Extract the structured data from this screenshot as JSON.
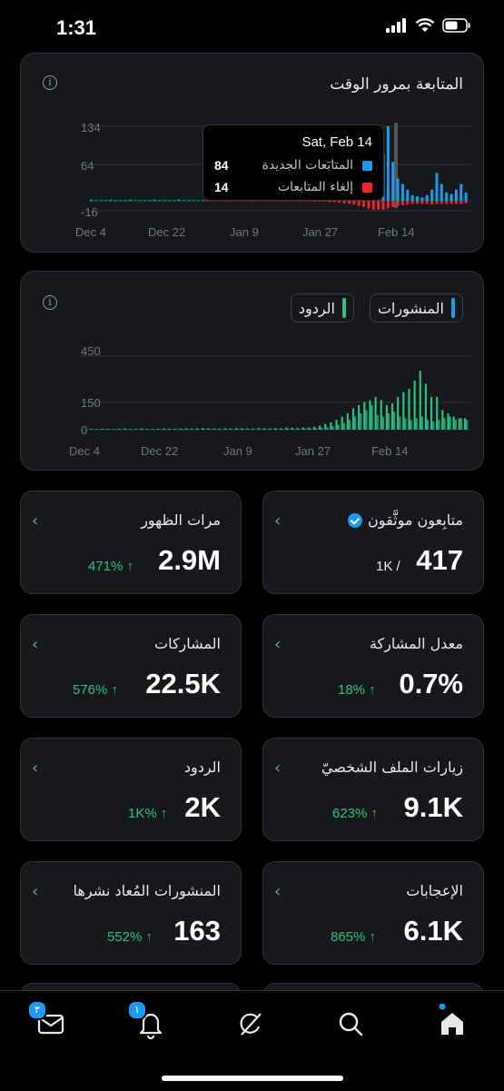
{
  "status": {
    "time": "1:31"
  },
  "followers_card": {
    "title": "المتابعة بمرور الوقت",
    "y_ticks": [
      "134",
      "64",
      "-16"
    ],
    "x_ticks": [
      "Dec 4",
      "Dec 22",
      "Jan 9",
      "Jan 27",
      "Feb 14"
    ],
    "tooltip": {
      "date": "Sat, Feb 14",
      "new_label": "المتابَعات الجديدة",
      "new_value": "84",
      "lost_label": "إلغاء المتابعات",
      "lost_value": "14"
    }
  },
  "posts_card": {
    "chip_posts": "المنشورات",
    "chip_replies": "الردود",
    "y_ticks": [
      "450",
      "150",
      "0"
    ],
    "x_ticks": [
      "Dec 4",
      "Dec 22",
      "Jan 9",
      "Jan 27",
      "Feb 14"
    ]
  },
  "stats": {
    "verified_followers": {
      "title": "متابِعون موثَّقون",
      "value": "417",
      "sub": "1K /"
    },
    "impressions": {
      "title": "مرات الظهور",
      "value": "2.9M",
      "change": "471% ↑"
    },
    "engagement_rate": {
      "title": "معدل المشاركة",
      "value": "0.7%",
      "change": "18% ↑"
    },
    "engagements": {
      "title": "المشاركات",
      "value": "22.5K",
      "change": "576% ↑"
    },
    "profile_visits": {
      "title": "زيارات الملف الشخصيّ",
      "value": "9.1K",
      "change": "623% ↑"
    },
    "replies": {
      "title": "الردود",
      "value": "2K",
      "change": "1K% ↑"
    },
    "likes": {
      "title": "الإعجابات",
      "value": "6.1K",
      "change": "865% ↑"
    },
    "reposts": {
      "title": "المنشورات المُعاد نشرها",
      "value": "163",
      "change": "552% ↑"
    }
  },
  "nav": {
    "messages_badge": "٣",
    "notifications_badge": "١"
  },
  "colors": {
    "accent": "#1d9bf0",
    "loss": "#f4212e",
    "positive": "#2ec27e",
    "posts_bar": "#1fa17a",
    "replies_bar": "#2ec27e"
  },
  "chart_data": [
    {
      "type": "bar",
      "title": "المتابعة بمرور الوقت",
      "x_range": [
        "Dec 4",
        "Feb 20"
      ],
      "ylim": [
        -16,
        134
      ],
      "series": [
        {
          "name": "المتابَعات الجديدة",
          "values": [
            2,
            1,
            1,
            1,
            2,
            1,
            1,
            1,
            2,
            1,
            1,
            1,
            1,
            2,
            1,
            1,
            1,
            1,
            2,
            1,
            1,
            1,
            1,
            1,
            2,
            1,
            1,
            1,
            1,
            2,
            1,
            1,
            1,
            1,
            1,
            2,
            1,
            1,
            1,
            2,
            1,
            1,
            1,
            2,
            1,
            2,
            2,
            1,
            2,
            3,
            2,
            3,
            4,
            5,
            8,
            12,
            15,
            20,
            40,
            60,
            84,
            140,
            70,
            40,
            30,
            20,
            10,
            8,
            6,
            10,
            20,
            50,
            30,
            15,
            12,
            20,
            30,
            15
          ]
        },
        {
          "name": "إلغاء المتابعات",
          "values": [
            0,
            0,
            0,
            0,
            0,
            1,
            0,
            0,
            0,
            0,
            0,
            1,
            0,
            0,
            0,
            0,
            0,
            1,
            0,
            0,
            0,
            0,
            0,
            1,
            0,
            0,
            0,
            0,
            1,
            0,
            0,
            0,
            0,
            1,
            0,
            0,
            0,
            1,
            0,
            0,
            1,
            0,
            0,
            1,
            0,
            1,
            1,
            1,
            1,
            2,
            2,
            3,
            4,
            5,
            6,
            8,
            10,
            12,
            14,
            14,
            14,
            12,
            10,
            8,
            7,
            6,
            5,
            5,
            5,
            5,
            6,
            5,
            5,
            5,
            5,
            5,
            5,
            4
          ]
        }
      ]
    },
    {
      "type": "bar",
      "x_range": [
        "Dec 4",
        "Feb 20"
      ],
      "ylim": [
        0,
        450
      ],
      "series": [
        {
          "name": "المنشورات",
          "values": [
            3,
            2,
            4,
            3,
            2,
            3,
            4,
            2,
            3,
            4,
            3,
            2,
            3,
            5,
            4,
            3,
            4,
            5,
            3,
            4,
            6,
            5,
            4,
            3,
            5,
            4,
            6,
            5,
            4,
            3,
            6,
            5,
            4,
            6,
            5,
            7,
            6,
            5,
            8,
            7,
            9,
            12,
            15,
            20,
            30,
            40,
            60,
            80,
            100,
            120,
            150,
            90,
            80,
            100,
            110,
            80,
            70,
            60,
            70,
            80,
            60,
            50,
            60,
            70,
            80,
            60,
            70,
            60
          ]
        },
        {
          "name": "الردود",
          "values": [
            5,
            4,
            6,
            5,
            4,
            6,
            7,
            5,
            6,
            8,
            6,
            5,
            6,
            8,
            7,
            6,
            7,
            9,
            7,
            8,
            10,
            9,
            8,
            7,
            9,
            8,
            10,
            9,
            8,
            7,
            10,
            9,
            8,
            10,
            9,
            12,
            11,
            10,
            14,
            13,
            18,
            25,
            35,
            45,
            60,
            80,
            100,
            130,
            150,
            170,
            180,
            200,
            180,
            150,
            160,
            200,
            230,
            250,
            300,
            360,
            280,
            200,
            200,
            120,
            100,
            80,
            70,
            70
          ]
        }
      ]
    }
  ]
}
